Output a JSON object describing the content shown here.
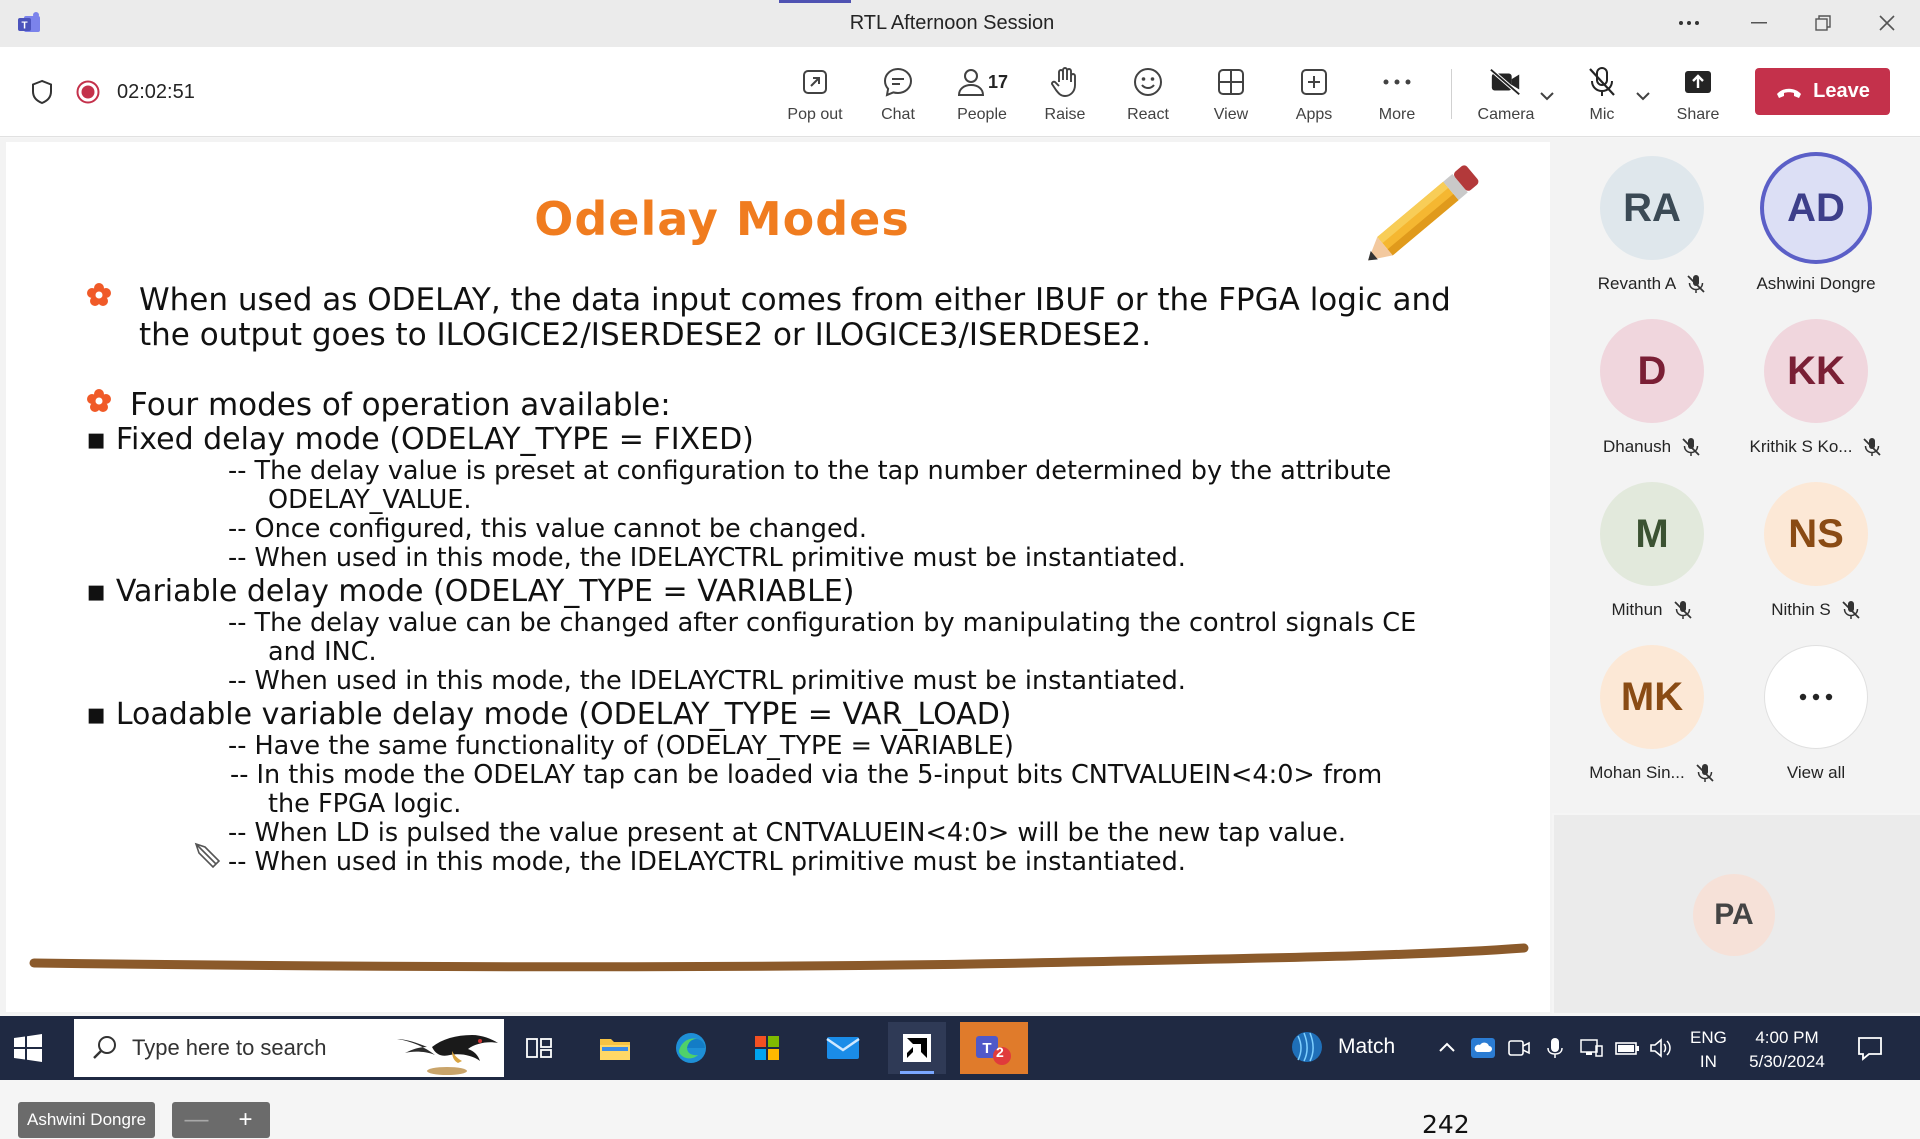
{
  "window": {
    "title": "RTL Afternoon Session"
  },
  "meeting": {
    "elapsed": "02:02:51",
    "people_count": "17",
    "tools": {
      "popout": "Pop out",
      "chat": "Chat",
      "people": "People",
      "raise": "Raise",
      "react": "React",
      "view": "View",
      "apps": "Apps",
      "more": "More",
      "camera": "Camera",
      "mic": "Mic",
      "share": "Share"
    },
    "leave_label": "Leave"
  },
  "slide": {
    "title": "Odelay Modes",
    "bullet1_line1": "When used as ODELAY, the data input comes from either IBUF or the FPGA logic and",
    "bullet1_line2": "the output goes to ILOGICE2/ISERDESE2 or ILOGICE3/ISERDESE2.",
    "bullet2": "Four modes of operation available:",
    "mode1": "▪ Fixed delay mode (ODELAY_TYPE = FIXED)",
    "mode1_sub1a": "-- The delay value is preset at configuration to the tap number determined by the attribute",
    "mode1_sub1b": "ODELAY_VALUE.",
    "mode1_sub2": "-- Once configured, this value cannot be changed.",
    "mode1_sub3": "-- When used in this mode, the IDELAYCTRL primitive must be instantiated.",
    "mode2": "▪ Variable delay mode (ODELAY_TYPE = VARIABLE)",
    "mode2_sub1a": "--  The delay value can be changed after configuration by manipulating the control signals CE",
    "mode2_sub1b": "and INC.",
    "mode2_sub2": "-- When used in this mode, the IDELAYCTRL primitive must be instantiated.",
    "mode3": "▪ Loadable variable delay mode (ODELAY_TYPE = VAR_LOAD)",
    "mode3_sub1": "-- Have the same functionality of (ODELAY_TYPE = VARIABLE)",
    "mode3_sub2a": "-- In this mode the ODELAY tap can be loaded via the 5-input bits CNTVALUEIN<4:0> from",
    "mode3_sub2b": "the FPGA logic.",
    "mode3_sub3": "-- When LD is pulsed the value present at CNTVALUEIN<4:0> will be the new tap value.",
    "mode3_sub4": "-- When used in this mode, the IDELAYCTRL primitive must be instantiated.",
    "page_number": "242",
    "presenter": "Ashwini Dongre",
    "zoom_minus": "—",
    "zoom_plus": "+"
  },
  "participants": [
    {
      "initials": "RA",
      "name": "Revanth A",
      "muted": true,
      "bg": "#dfe7ec",
      "fg": "#3b4a55"
    },
    {
      "initials": "AD",
      "name": "Ashwini Dongre",
      "muted": false,
      "bg": "#dcdff5",
      "fg": "#3d3f8a"
    },
    {
      "initials": "D",
      "name": "Dhanush",
      "muted": true,
      "bg": "#f0d6dd",
      "fg": "#7a1f35"
    },
    {
      "initials": "KK",
      "name": "Krithik S Ko...",
      "muted": true,
      "bg": "#f0d6dd",
      "fg": "#7a1f35"
    },
    {
      "initials": "M",
      "name": "Mithun",
      "muted": true,
      "bg": "#e2e9dc",
      "fg": "#3b5232"
    },
    {
      "initials": "NS",
      "name": "Nithin S",
      "muted": true,
      "bg": "#fce8d6",
      "fg": "#8a4b14"
    },
    {
      "initials": "MK",
      "name": "Mohan Sin...",
      "muted": true,
      "bg": "#fce8d6",
      "fg": "#8a4b14"
    },
    {
      "initials": "PA",
      "name": "",
      "muted": false,
      "bg": "#f6e1d8",
      "fg": "#444444"
    }
  ],
  "view_all_label": "View all",
  "taskbar": {
    "search_placeholder": "Type here to search",
    "weather": "Match",
    "lang_top": "ENG",
    "lang_bottom": "IN",
    "time": "4:00 PM",
    "date": "5/30/2024",
    "teams_badge": "2"
  },
  "colors": {
    "leave": "#c4314b",
    "title_orange": "#f07c1f",
    "accent": "#5b5fc7",
    "taskbar": "#1f2942"
  }
}
